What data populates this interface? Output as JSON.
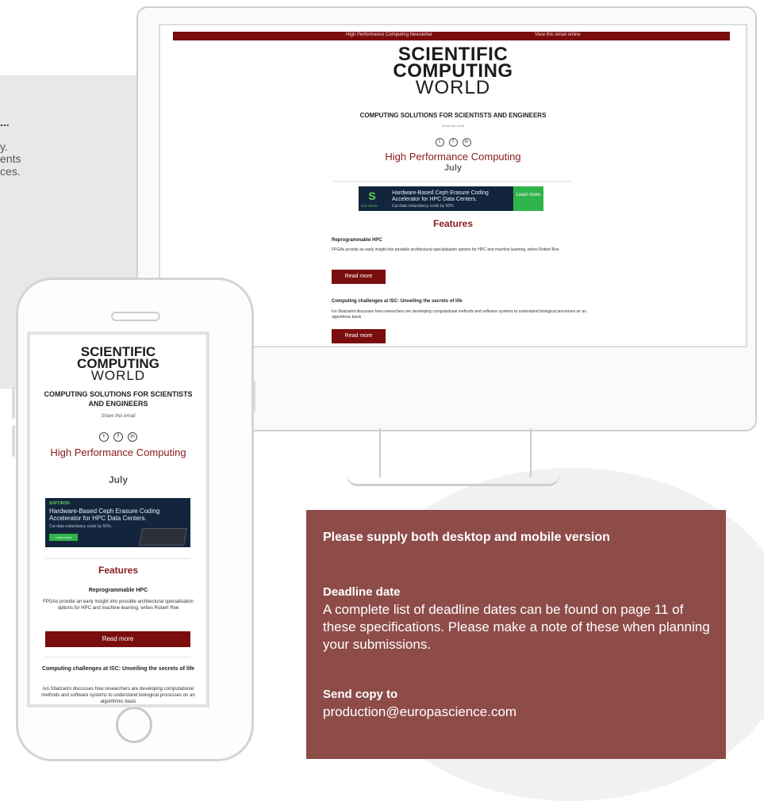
{
  "left_column": {
    "line0": "...",
    "line1": "y.",
    "line2": "ents",
    "line3": "ces."
  },
  "desktop": {
    "topbar_left": "High Performance Computing Newsletter",
    "topbar_right": "View this email online",
    "logo_line1": "SCIENTIFIC",
    "logo_line2": "COMPUTING",
    "logo_line3": "WORLD",
    "tagline": "COMPUTING SOLUTIONS FOR SCIENTISTS AND ENGINEERS",
    "share": "Share this email",
    "newsletter_title": "High Performance Computing",
    "month": "July",
    "ad": {
      "brand": "SOFTIRON",
      "headline": "Hardware-Based Ceph Erasure Coding Accelerator for HPC Data Centers.",
      "subline": "Cut data redundancy costs by 50%",
      "cta": "Learn more"
    },
    "features_heading": "Features",
    "articles": [
      {
        "title": "Reprogrammable HPC",
        "body": "FPGAs provide an early insight into possible architectural specialisation options for HPC and machine learning, writes Robert Roe",
        "button": "Read more"
      },
      {
        "title": "Computing challenges at ISC: Unveiling the secrets of life",
        "body": "Ivo Sbalzarini discusses how researchers are developing computational methods and software systems to understand biological processes on an algorithmic basis",
        "button": "Read more"
      }
    ]
  },
  "mobile": {
    "logo_line1": "SCIENTIFIC",
    "logo_line2": "COMPUTING",
    "logo_line3": "WORLD",
    "tagline": "COMPUTING SOLUTIONS FOR SCIENTISTS AND ENGINEERS",
    "share": "Share this email",
    "newsletter_title": "High Performance Computing",
    "month": "July",
    "ad": {
      "brand": "SOFTIRON",
      "headline": "Hardware-Based Ceph Erasure Coding Accelerator for HPC Data Centers.",
      "subline": "Cut data redundancy costs by 50%.",
      "cta": "Learn more"
    },
    "features_heading": "Features",
    "articles": [
      {
        "title": "Reprogrammable HPC",
        "body": "FPGAs provide an early insight into possible architectural specialisation options for HPC and machine learning, writes Robert Roe",
        "button": "Read more"
      },
      {
        "title": "Computing challenges at ISC: Unveiling the secrets of life",
        "body": "Ivo Sbalzarini discusses how researchers are developing computational methods and software systems to understand biological processes on an algorithmic basis"
      }
    ]
  },
  "social_icons": [
    "twitter-icon",
    "facebook-icon",
    "linkedin-icon"
  ],
  "info_box": {
    "supply_note": "Please supply both desktop and mobile version",
    "deadline_heading": "Deadline date",
    "deadline_text": "A complete list of deadline dates can be found on page 11 of these specifications. Please make a note of these when planning your submissions.",
    "send_heading": "Send copy to",
    "send_email": "production@europascience.com"
  },
  "colors": {
    "brand_red": "#7a0e0e",
    "info_box_bg": "#8e4c49",
    "ad_bg": "#13253c",
    "ad_accent": "#2fb44a"
  }
}
